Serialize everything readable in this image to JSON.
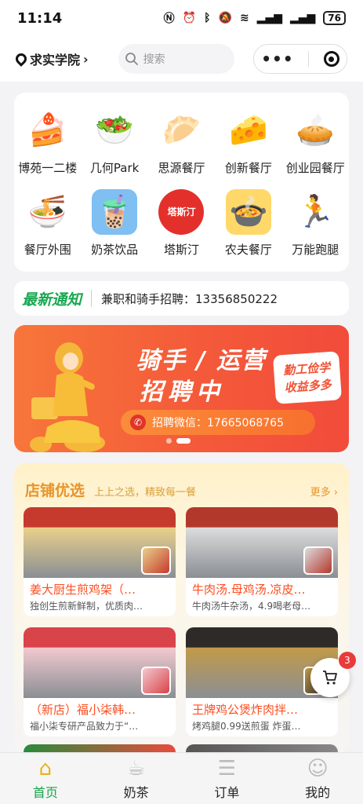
{
  "status_bar": {
    "time": "11:14",
    "battery": "76"
  },
  "header": {
    "location": "求实学院",
    "search_placeholder": "搜索"
  },
  "categories": [
    {
      "label": "博苑一二楼",
      "icon": "cake-icon",
      "emoji": "🍰",
      "bg": "#ffffff"
    },
    {
      "label": "几何Park",
      "icon": "salad-bowl-icon",
      "emoji": "🥗",
      "bg": "#ffffff"
    },
    {
      "label": "思源餐厅",
      "icon": "dumpling-plate-icon",
      "emoji": "🥟",
      "bg": "#ffffff"
    },
    {
      "label": "创新餐厅",
      "icon": "nachos-icon",
      "emoji": "🧀",
      "bg": "#ffffff"
    },
    {
      "label": "创业园餐厅",
      "icon": "pie-icon",
      "emoji": "🥧",
      "bg": "#ffffff"
    },
    {
      "label": "餐厅外围",
      "icon": "noodle-bowl-icon",
      "emoji": "🍜",
      "bg": "#ffffff"
    },
    {
      "label": "奶茶饮品",
      "icon": "milk-tea-jar-icon",
      "emoji": "🧋",
      "bg": "#7fbff2"
    },
    {
      "label": "塔斯汀",
      "icon": "tastien-logo-icon",
      "emoji": "塔斯汀",
      "bg": "#e4302a"
    },
    {
      "label": "农夫餐厅",
      "icon": "soup-pot-icon",
      "emoji": "🍲",
      "bg": "#ffd86a"
    },
    {
      "label": "万能跑腿",
      "icon": "runner-icon",
      "emoji": "🏃",
      "bg": "#ffffff"
    }
  ],
  "notice": {
    "title": "最新通知",
    "text": "兼职和骑手招聘：13356850222"
  },
  "banner": {
    "headline_1": "骑手 / 运营",
    "headline_2": "招聘中",
    "badge_line1": "勤工俭学",
    "badge_line2": "收益多多",
    "wechat": "招聘微信：17665068765"
  },
  "shops": {
    "title": "店铺优选",
    "subtitle": "上上之选，精致每一餐",
    "more": "更多",
    "items": [
      {
        "name": "姜大厨生煎鸡架（…",
        "desc": "独创生煎新鲜制，优质肉…",
        "color_a": "#c63a2e",
        "color_b": "#e9d08a"
      },
      {
        "name": "牛肉汤.母鸡汤.凉皮…",
        "desc": "牛肉汤牛杂汤，4.9喝老母…",
        "color_a": "#b3382c",
        "color_b": "#dcdcdc"
      },
      {
        "name": "（新店）福小柒韩…",
        "desc": "福小柒专研产品致力于“…",
        "color_a": "#d9434a",
        "color_b": "#f2c9cf"
      },
      {
        "name": "王牌鸡公煲炸肉拌…",
        "desc": "烤鸡腿0.99送煎蛋 炸蛋…",
        "color_a": "#2d2a28",
        "color_b": "#c29a48"
      }
    ]
  },
  "cart": {
    "count": "3"
  },
  "tabs": [
    {
      "label": "首页",
      "icon": "home-icon",
      "glyph": "⌂"
    },
    {
      "label": "奶茶",
      "icon": "milk-tea-icon",
      "glyph": "☕"
    },
    {
      "label": "订单",
      "icon": "order-list-icon",
      "glyph": "☰"
    },
    {
      "label": "我的",
      "icon": "user-icon",
      "glyph": "☺"
    }
  ]
}
